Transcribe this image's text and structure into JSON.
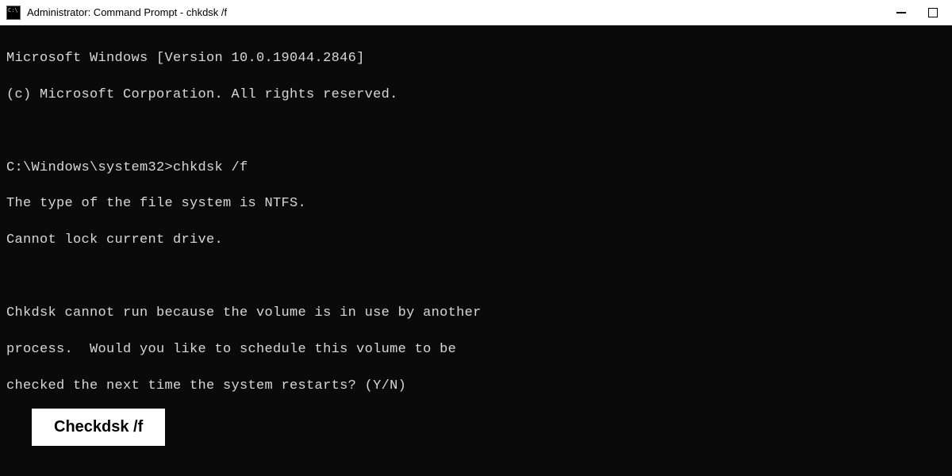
{
  "window": {
    "title": "Administrator: Command Prompt - chkdsk  /f"
  },
  "terminal": {
    "line1": "Microsoft Windows [Version 10.0.19044.2846]",
    "line2": "(c) Microsoft Corporation. All rights reserved.",
    "blank1": " ",
    "prompt": "C:\\Windows\\system32>",
    "command": "chkdsk /f",
    "line3": "The type of the file system is NTFS.",
    "line4": "Cannot lock current drive.",
    "blank2": " ",
    "line5": "Chkdsk cannot run because the volume is in use by another",
    "line6": "process.  Would you like to schedule this volume to be",
    "line7": "checked the next time the system restarts? (Y/N)"
  },
  "caption": {
    "text": "Checkdsk /f"
  }
}
